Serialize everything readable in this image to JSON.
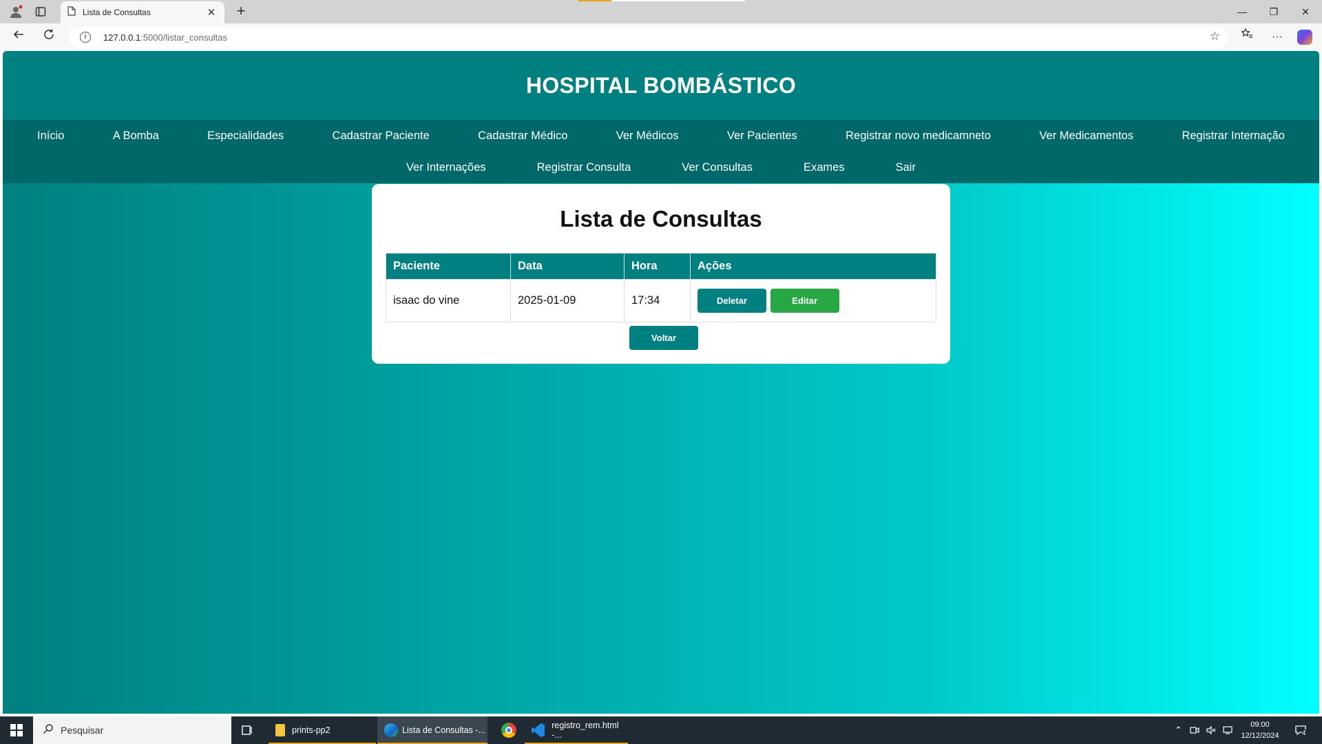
{
  "browser": {
    "tab_title": "Lista de Consultas",
    "tab_close": "✕",
    "new_tab": "+",
    "url_host": "127.0.0.1",
    "url_path": ":5000/listar_consultas",
    "window_controls": {
      "minimize": "—",
      "restore": "❐",
      "close": "✕"
    }
  },
  "site": {
    "title": "HOSPITAL BOMBÁSTICO",
    "nav_row1": [
      "Início",
      "A Bomba",
      "Especialidades",
      "Cadastrar Paciente",
      "Cadastrar Médico",
      "Ver Médicos",
      "Ver Pacientes",
      "Registrar novo medicamneto",
      "Ver Medicamentos",
      "Registrar Internação"
    ],
    "nav_row2": [
      "Ver Internações",
      "Registrar Consulta",
      "Ver Consultas",
      "Exames",
      "Sair"
    ]
  },
  "page": {
    "heading": "Lista de Consultas",
    "table": {
      "headers": [
        "Paciente",
        "Data",
        "Hora",
        "Ações"
      ],
      "rows": [
        {
          "paciente": "isaac do vine",
          "data": "2025-01-09",
          "hora": "17:34"
        }
      ],
      "actions": {
        "delete_label": "Deletar",
        "edit_label": "Editar"
      }
    },
    "back_label": "Voltar",
    "colors": {
      "primary": "#008080",
      "nav": "#006868",
      "edit": "#28a745"
    }
  },
  "taskbar": {
    "search_placeholder": "Pesquisar",
    "items": [
      "prints-pp2",
      "Lista de Consultas -...",
      "registro_rem.html -..."
    ],
    "time": "09:00",
    "date": "12/12/2024",
    "notification_count": "4"
  }
}
